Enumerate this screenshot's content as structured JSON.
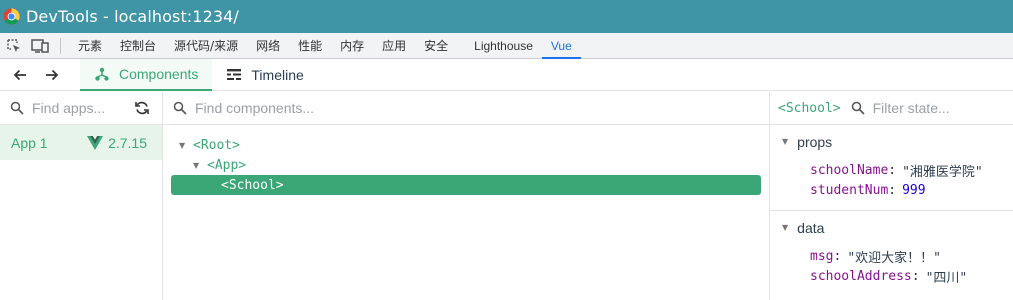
{
  "window": {
    "title": "DevTools - localhost:1234/"
  },
  "devtools_tabs": [
    {
      "label": "元素"
    },
    {
      "label": "控制台"
    },
    {
      "label": "源代码/来源"
    },
    {
      "label": "网络"
    },
    {
      "label": "性能"
    },
    {
      "label": "内存"
    },
    {
      "label": "应用"
    },
    {
      "label": "安全"
    },
    {
      "label": "Lighthouse"
    },
    {
      "label": "Vue"
    }
  ],
  "vue_toolbar": {
    "components_label": "Components",
    "timeline_label": "Timeline"
  },
  "apps_pane": {
    "search_placeholder": "Find apps...",
    "app": {
      "name": "App 1",
      "version": "2.7.15"
    }
  },
  "tree_pane": {
    "search_placeholder": "Find components...",
    "nodes": [
      "<Root>",
      "<App>",
      "<School>"
    ]
  },
  "state_pane": {
    "component_tag": "<School>",
    "search_placeholder": "Filter state...",
    "props_title": "props",
    "props": [
      {
        "key": "schoolName",
        "value": "\"湘雅医学院\""
      },
      {
        "key": "studentNum",
        "value": "999"
      }
    ],
    "data_title": "data",
    "data": [
      {
        "key": "msg",
        "value": "\"欢迎大家！！\""
      },
      {
        "key": "schoolAddress",
        "value": "\"四川\""
      }
    ]
  },
  "colors": {
    "accent": "#3ba776",
    "titlebar": "#3f94a6",
    "devtools_active": "#1a73e8"
  }
}
